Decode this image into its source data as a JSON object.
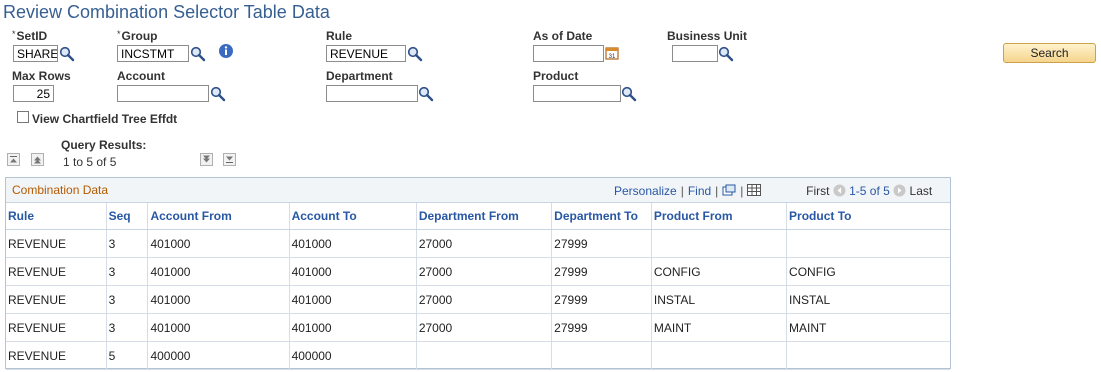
{
  "page": {
    "title": "Review Combination Selector Table Data"
  },
  "criteria": {
    "setid": {
      "label": "SetID",
      "value": "SHARE"
    },
    "group": {
      "label": "Group",
      "value": "INCSTMT"
    },
    "rule": {
      "label": "Rule",
      "value": "REVENUE"
    },
    "as_of_date": {
      "label": "As of Date",
      "value": ""
    },
    "business_unit": {
      "label": "Business Unit",
      "value": ""
    },
    "max_rows": {
      "label": "Max Rows",
      "value": "25"
    },
    "account": {
      "label": "Account",
      "value": ""
    },
    "department": {
      "label": "Department",
      "value": ""
    },
    "product": {
      "label": "Product",
      "value": ""
    },
    "view_tree_label": "View Chartfield Tree Effdt",
    "search_label": "Search",
    "required_mark": "*"
  },
  "query": {
    "label": "Query Results:",
    "range": "1 to 5 of 5"
  },
  "grid": {
    "title": "Combination Data",
    "personalize": "Personalize",
    "find": "Find",
    "first": "First",
    "range": "1-5 of 5",
    "last": "Last",
    "columns": [
      "Rule",
      "Seq",
      "Account From",
      "Account To",
      "Department From",
      "Department To",
      "Product From",
      "Product To"
    ],
    "rows": [
      [
        "REVENUE",
        "3",
        "401000",
        "401000",
        "27000",
        "27999",
        "",
        ""
      ],
      [
        "REVENUE",
        "3",
        "401000",
        "401000",
        "27000",
        "27999",
        "CONFIG",
        "CONFIG"
      ],
      [
        "REVENUE",
        "3",
        "401000",
        "401000",
        "27000",
        "27999",
        "INSTAL",
        "INSTAL"
      ],
      [
        "REVENUE",
        "3",
        "401000",
        "401000",
        "27000",
        "27999",
        "MAINT",
        "MAINT"
      ],
      [
        "REVENUE",
        "5",
        "400000",
        "400000",
        "",
        "",
        "",
        ""
      ]
    ]
  },
  "colors": {
    "title": "#365f91",
    "link": "#2857a4",
    "grid_title": "#b35a00",
    "button": "#f5d48d"
  }
}
